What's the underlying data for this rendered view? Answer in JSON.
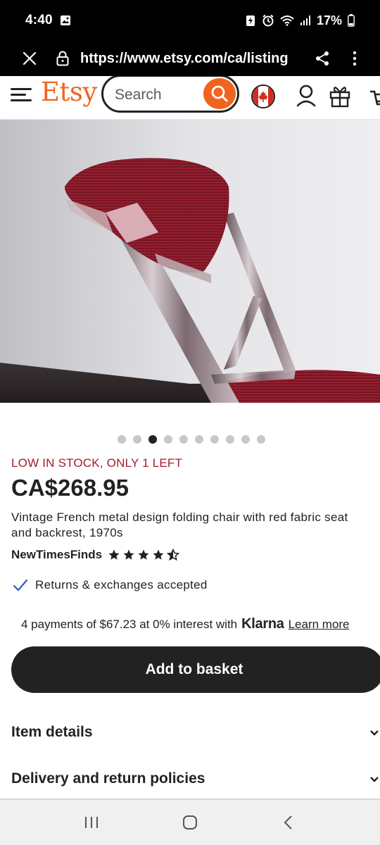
{
  "status_bar": {
    "time": "4:40",
    "battery": "17%"
  },
  "browser": {
    "url": "https://www.etsy.com/ca/listing"
  },
  "header": {
    "logo": "Etsy",
    "search_placeholder": "Search"
  },
  "product": {
    "image_count": 10,
    "active_image_index": 2,
    "stock_message": "LOW IN STOCK, ONLY 1 LEFT",
    "price": "CA$268.95",
    "title": "Vintage French metal design folding chair with red fabric seat and backrest, 1970s",
    "shop_name": "NewTimesFinds",
    "rating": 4.5,
    "returns_text": "Returns & exchanges accepted",
    "klarna_text": "4 payments of $67.23 at 0% interest with",
    "klarna_brand": "Klarna",
    "klarna_link": "Learn more",
    "add_to_basket": "Add to basket"
  },
  "accordions": [
    {
      "label": "Item details"
    },
    {
      "label": "Delivery and return policies"
    }
  ],
  "colors": {
    "brand_orange": "#f1641e",
    "stock_red": "#a61a2e",
    "button_dark": "#222222",
    "check_blue": "#2b5fbd"
  }
}
